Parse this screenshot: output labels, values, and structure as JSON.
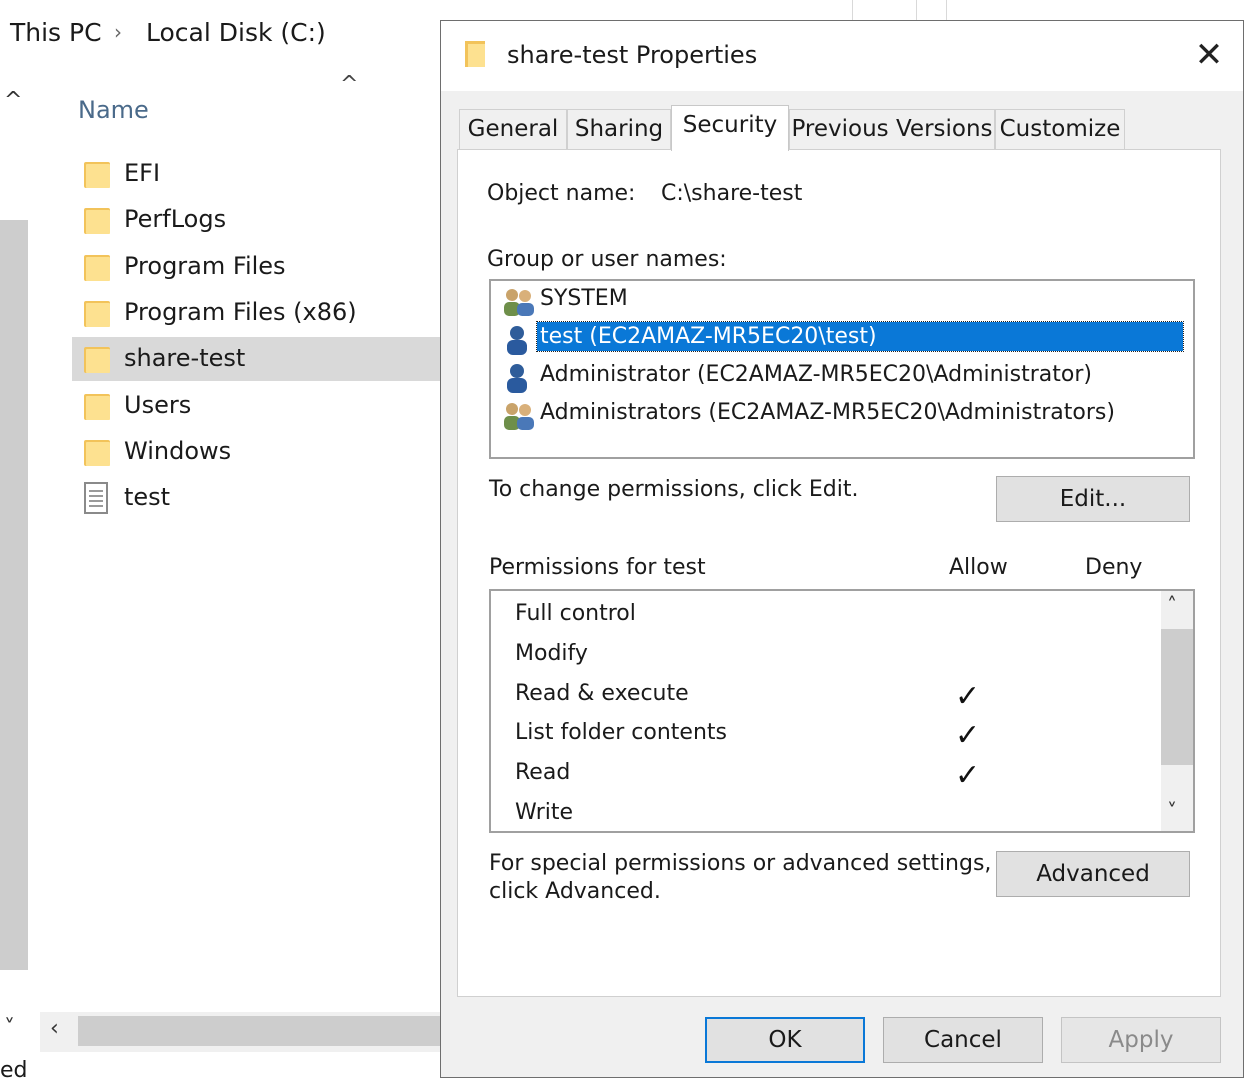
{
  "explorer": {
    "breadcrumb": [
      "This PC",
      "Local Disk (C:)"
    ],
    "column_header": "Name",
    "files": [
      {
        "name": "EFI",
        "type": "folder",
        "selected": false
      },
      {
        "name": "PerfLogs",
        "type": "folder",
        "selected": false
      },
      {
        "name": "Program Files",
        "type": "folder",
        "selected": false
      },
      {
        "name": "Program Files (x86)",
        "type": "folder",
        "selected": false
      },
      {
        "name": "share-test",
        "type": "folder",
        "selected": true
      },
      {
        "name": "Users",
        "type": "folder",
        "selected": false
      },
      {
        "name": "Windows",
        "type": "folder",
        "selected": false
      },
      {
        "name": "test",
        "type": "file",
        "selected": false
      }
    ],
    "status_fragment": "ed"
  },
  "dialog": {
    "title": "share-test Properties",
    "close_glyph": "✕",
    "tabs": [
      {
        "label": "General",
        "active": false
      },
      {
        "label": "Sharing",
        "active": false
      },
      {
        "label": "Security",
        "active": true
      },
      {
        "label": "Previous Versions",
        "active": false
      },
      {
        "label": "Customize",
        "active": false
      }
    ],
    "object_name_label": "Object name:",
    "object_name_value": "C:\\share-test",
    "group_label": "Group or user names:",
    "users": [
      {
        "name": "SYSTEM",
        "icon": "group-users-icon",
        "selected": false
      },
      {
        "name": "test (EC2AMAZ-MR5EC20\\test)",
        "icon": "user-icon",
        "selected": true
      },
      {
        "name": "Administrator (EC2AMAZ-MR5EC20\\Administrator)",
        "icon": "user-icon",
        "selected": false
      },
      {
        "name": "Administrators (EC2AMAZ-MR5EC20\\Administrators)",
        "icon": "group-users-icon",
        "selected": false
      }
    ],
    "change_hint": "To change permissions, click Edit.",
    "edit_button": "Edit...",
    "permissions_label": "Permissions for test",
    "allow_header": "Allow",
    "deny_header": "Deny",
    "permissions": [
      {
        "name": "Full control",
        "allow": false,
        "deny": false
      },
      {
        "name": "Modify",
        "allow": false,
        "deny": false
      },
      {
        "name": "Read & execute",
        "allow": true,
        "deny": false
      },
      {
        "name": "List folder contents",
        "allow": true,
        "deny": false
      },
      {
        "name": "Read",
        "allow": true,
        "deny": false
      },
      {
        "name": "Write",
        "allow": false,
        "deny": false
      }
    ],
    "special_hint_line1": "For special permissions or advanced settings,",
    "special_hint_line2": "click Advanced.",
    "advanced_button": "Advanced",
    "ok_button": "OK",
    "cancel_button": "Cancel",
    "apply_button": "Apply",
    "check_glyph": "✓",
    "colors": {
      "selection": "#0a78d7",
      "folder": "#fde190",
      "folder_dark": "#f2c35a"
    }
  }
}
